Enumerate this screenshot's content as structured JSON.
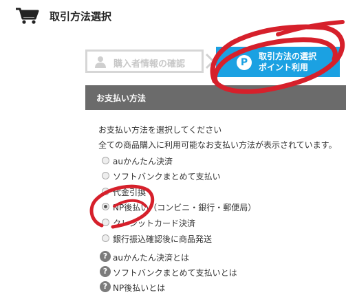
{
  "header": {
    "title": "取引方法選択",
    "icon": "cart-icon"
  },
  "steps": {
    "step1_label": "購入者情報の確認",
    "step2_line1": "取引方法の選択",
    "step2_line2": "ポイント利用",
    "step2_icon_text": "P",
    "active_color": "#1ba1e2"
  },
  "section": {
    "title": "お支払い方法"
  },
  "instructions": {
    "line1": "お支払い方法を選択してください",
    "line2": "全ての商品購入に利用可能なお支払い方法が表示されています。"
  },
  "payment_options": [
    {
      "label": "auかんたん決済",
      "selected": false
    },
    {
      "label": "ソフトバンクまとめて支払い",
      "selected": false
    },
    {
      "label": "代金引換",
      "selected": false
    },
    {
      "label": "NP後払い（コンビニ・銀行・郵便局）",
      "selected": true
    },
    {
      "label": "クレジットカード決済",
      "selected": false
    },
    {
      "label": "銀行振込確認後に商品発送",
      "selected": false
    }
  ],
  "help_links": [
    {
      "label": "auかんたん決済とは"
    },
    {
      "label": "ソフトバンクまとめて支払いとは"
    },
    {
      "label": "NP後払いとは"
    }
  ],
  "help_icon_text": "?",
  "annotation_color": "#d6202b"
}
